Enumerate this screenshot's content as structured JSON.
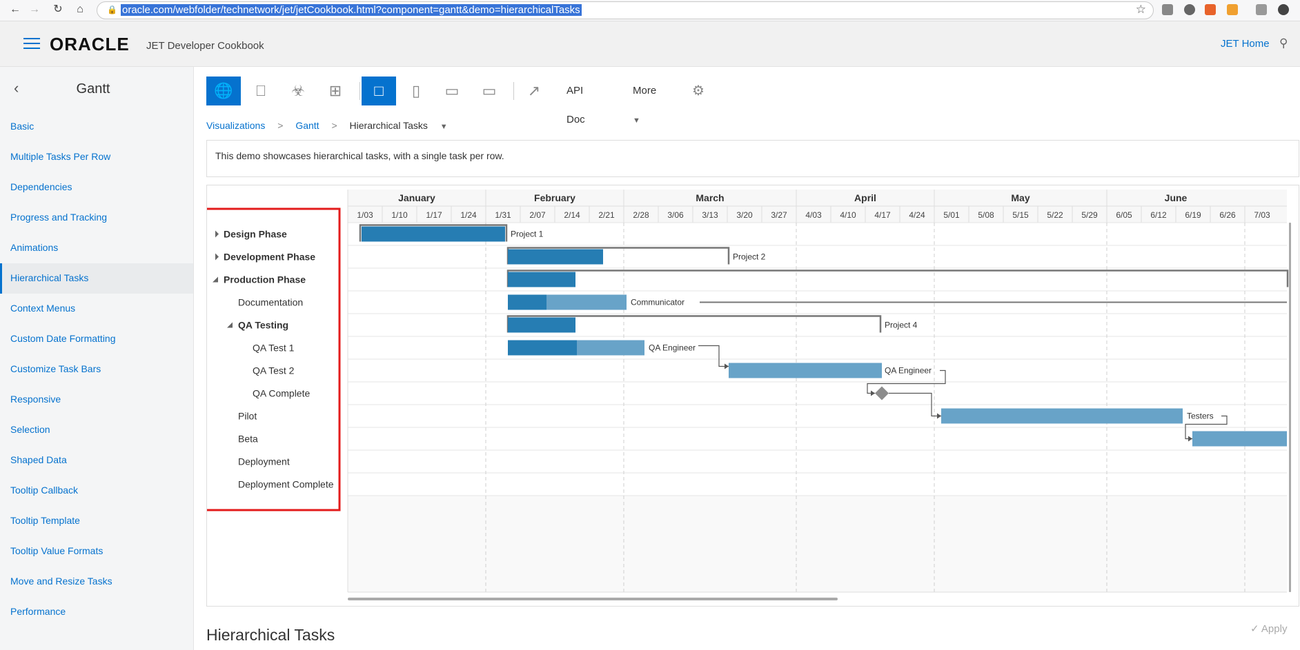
{
  "browser": {
    "url": "oracle.com/webfolder/technetwork/jet/jetCookbook.html?component=gantt&demo=hierarchicalTasks"
  },
  "header": {
    "logo": "ORACLE",
    "title": "JET Developer Cookbook",
    "home_link": "JET Home"
  },
  "sidebar": {
    "title": "Gantt",
    "items": [
      {
        "label": "Basic"
      },
      {
        "label": "Multiple Tasks Per Row"
      },
      {
        "label": "Dependencies"
      },
      {
        "label": "Progress and Tracking"
      },
      {
        "label": "Animations"
      },
      {
        "label": "Hierarchical Tasks",
        "selected": true
      },
      {
        "label": "Context Menus"
      },
      {
        "label": "Custom Date Formatting"
      },
      {
        "label": "Customize Task Bars"
      },
      {
        "label": "Responsive"
      },
      {
        "label": "Selection"
      },
      {
        "label": "Shaped Data"
      },
      {
        "label": "Tooltip Callback"
      },
      {
        "label": "Tooltip Template"
      },
      {
        "label": "Tooltip Value Formats"
      },
      {
        "label": "Move and Resize Tasks"
      },
      {
        "label": "Performance"
      }
    ]
  },
  "toolbar": {
    "api_doc": "API Doc",
    "more": "More"
  },
  "breadcrumb": {
    "items": [
      "Visualizations",
      "Gantt",
      "Hierarchical Tasks"
    ]
  },
  "description": "This demo showcases hierarchical tasks, with a single task per row.",
  "gantt": {
    "months": [
      "January",
      "February",
      "March",
      "April",
      "May",
      "June"
    ],
    "weeks": [
      "1/03",
      "1/10",
      "1/17",
      "1/24",
      "1/31",
      "2/07",
      "2/14",
      "2/21",
      "2/28",
      "3/06",
      "3/13",
      "3/20",
      "3/27",
      "4/03",
      "4/10",
      "4/17",
      "4/24",
      "5/01",
      "5/08",
      "5/15",
      "5/22",
      "5/29",
      "6/05",
      "6/12",
      "6/19",
      "6/26",
      "7/03"
    ],
    "rows": [
      {
        "label": "Design Phase",
        "level": 0,
        "expander": "collapsed",
        "bold": true
      },
      {
        "label": "Development Phase",
        "level": 0,
        "expander": "collapsed",
        "bold": true
      },
      {
        "label": "Production Phase",
        "level": 0,
        "expander": "expanded",
        "bold": true
      },
      {
        "label": "Documentation",
        "level": 1
      },
      {
        "label": "QA Testing",
        "level": 1,
        "expander": "expanded",
        "bold": true
      },
      {
        "label": "QA Test 1",
        "level": 2
      },
      {
        "label": "QA Test 2",
        "level": 2
      },
      {
        "label": "QA Complete",
        "level": 2
      },
      {
        "label": "Pilot",
        "level": 1
      },
      {
        "label": "Beta",
        "level": 1
      },
      {
        "label": "Deployment",
        "level": 1
      },
      {
        "label": "Deployment Complete",
        "level": 1
      }
    ],
    "task_labels": [
      "Project 1",
      "Project 2",
      "Communicator",
      "Project 4",
      "QA Engineer",
      "QA Engineer",
      "Testers"
    ],
    "colors": {
      "dark": "#267db3",
      "light": "#68a3c8",
      "summary": "#777777",
      "milestone": "#8c8c8c",
      "highlight": "#e31b1b"
    }
  },
  "footer": {
    "title": "Hierarchical Tasks",
    "apply": "Apply"
  }
}
